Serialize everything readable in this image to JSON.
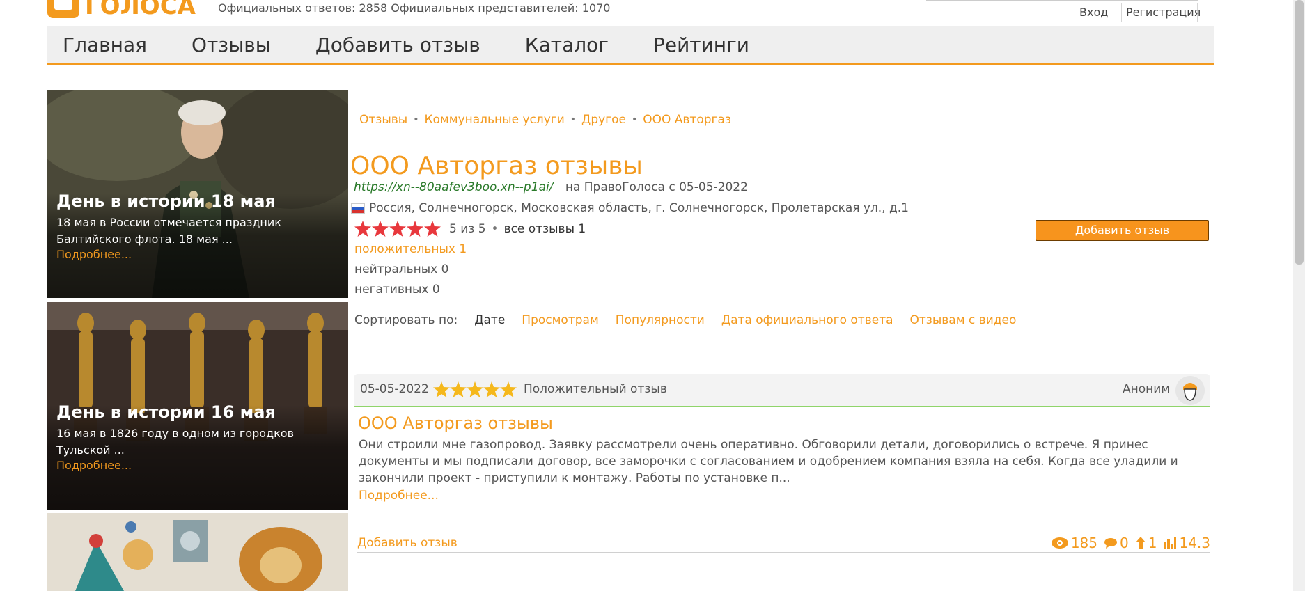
{
  "header": {
    "logo_text": "ГОЛОСА",
    "stats_text": "Официальных ответов: 2858 Официальных представителей: 1070",
    "login_label": "Вход",
    "register_label": "Регистрация"
  },
  "nav": {
    "items": [
      "Главная",
      "Отзывы",
      "Добавить отзыв",
      "Каталог",
      "Рейтинги"
    ]
  },
  "sidebar": {
    "cards": [
      {
        "title": "День в истории 18 мая",
        "text": "18 мая в России отмечается праздник Балтийского флота. 18 мая ...",
        "more": "Подробнее..."
      },
      {
        "title": "День в истории 16 мая",
        "text": "16 мая в 1826 году в одном из городков Тульской ...",
        "more": "Подробнее..."
      }
    ]
  },
  "breadcrumb": [
    "Отзывы",
    "Коммунальные услуги",
    "Другое",
    "ООО Авторгаз"
  ],
  "company": {
    "title": "ООО Авторгаз отзывы",
    "site": "https://xn--80aafev3boo.xn--p1ai/",
    "since": "на ПравоГолоса с 05-05-2022",
    "address": "Россия, Солнечногорск, Московская область, г. Солнечногорск, Пролетарская ул., д.1",
    "rating": 5,
    "rating_text": "5 из 5",
    "total_text": "все отзывы 1",
    "positive": "положительных 1",
    "neutral": "нейтральных 0",
    "negative": "негативных 0",
    "add_review": "Добавить отзыв"
  },
  "sort": {
    "label": "Сортировать по:",
    "active": "Дате",
    "options": [
      "Просмотрам",
      "Популярности",
      "Дата официального ответа",
      "Отзывам с видео"
    ]
  },
  "review": {
    "date": "05-05-2022",
    "stars": 5,
    "type": "Положительный отзыв",
    "author": "Аноним",
    "title": "ООО Авторгаз отзывы",
    "body": "Они строили мне газопровод. Заявку рассмотрели очень оперативно. Обговорили детали, договорились о встрече. Я принес документы и мы подписали договор, все заморочки с согласованием и одобрением компания взяла на себя. Когда все уладили и закончили проект - приступили к монтажу. Работы по установке п...",
    "more": "Подробнее...",
    "footer_add": "Добавить отзыв",
    "views": "185",
    "comments": "0",
    "likes": "1",
    "score": "14.3"
  },
  "colors": {
    "accent": "#f39a1e",
    "star_red": "#e8383d",
    "star_gold": "#f5b81c",
    "link_green": "#2a7a2a"
  }
}
